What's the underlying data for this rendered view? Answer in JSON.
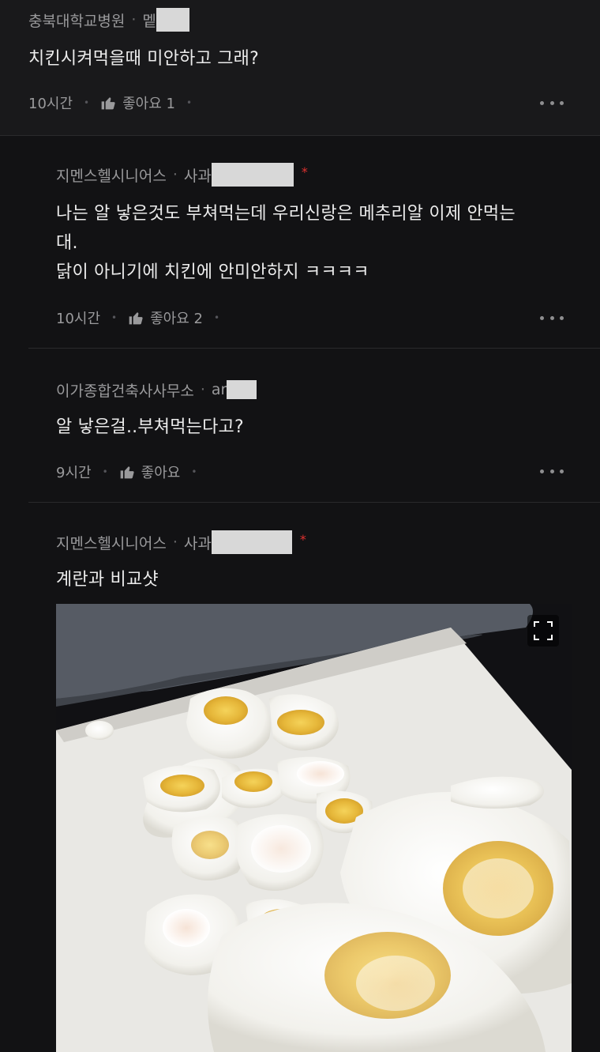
{
  "comments": [
    {
      "org": "충북대학교병원",
      "nick": "멭",
      "text_lines": [
        "치킨시켜먹을때 미안하고 그래?"
      ],
      "time": "10시간",
      "like_label": "좋아요 1"
    },
    {
      "org": "지멘스헬시니어스",
      "nick": "사과",
      "marker": "*",
      "text_lines": [
        "나는 알 낳은것도 부쳐먹는데 우리신랑은 메추리알 이제 안먹는",
        "대.",
        "닭이 아니기에 치킨에 안미안하지 ㅋㅋㅋㅋ"
      ],
      "time": "10시간",
      "like_label": "좋아요 2"
    },
    {
      "org": "이가종합건축사사무소",
      "nick": "ar",
      "text_lines": [
        "알 낳은걸..부쳐먹는다고?"
      ],
      "time": "9시간",
      "like_label": "좋아요"
    },
    {
      "org": "지멘스헬시니어스",
      "nick": "사과",
      "marker": "*",
      "text_lines": [
        "계란과 비교샷"
      ]
    }
  ],
  "icons": {
    "like": "thumbs-up-icon",
    "more": "more-horizontal-icon",
    "expand": "fullscreen-icon"
  },
  "photo": {
    "subject": "quail eggs and chicken eggs fried on a white plate"
  },
  "colors": {
    "background": "#121214",
    "top_background": "#19191b",
    "marker": "#e0312f"
  }
}
